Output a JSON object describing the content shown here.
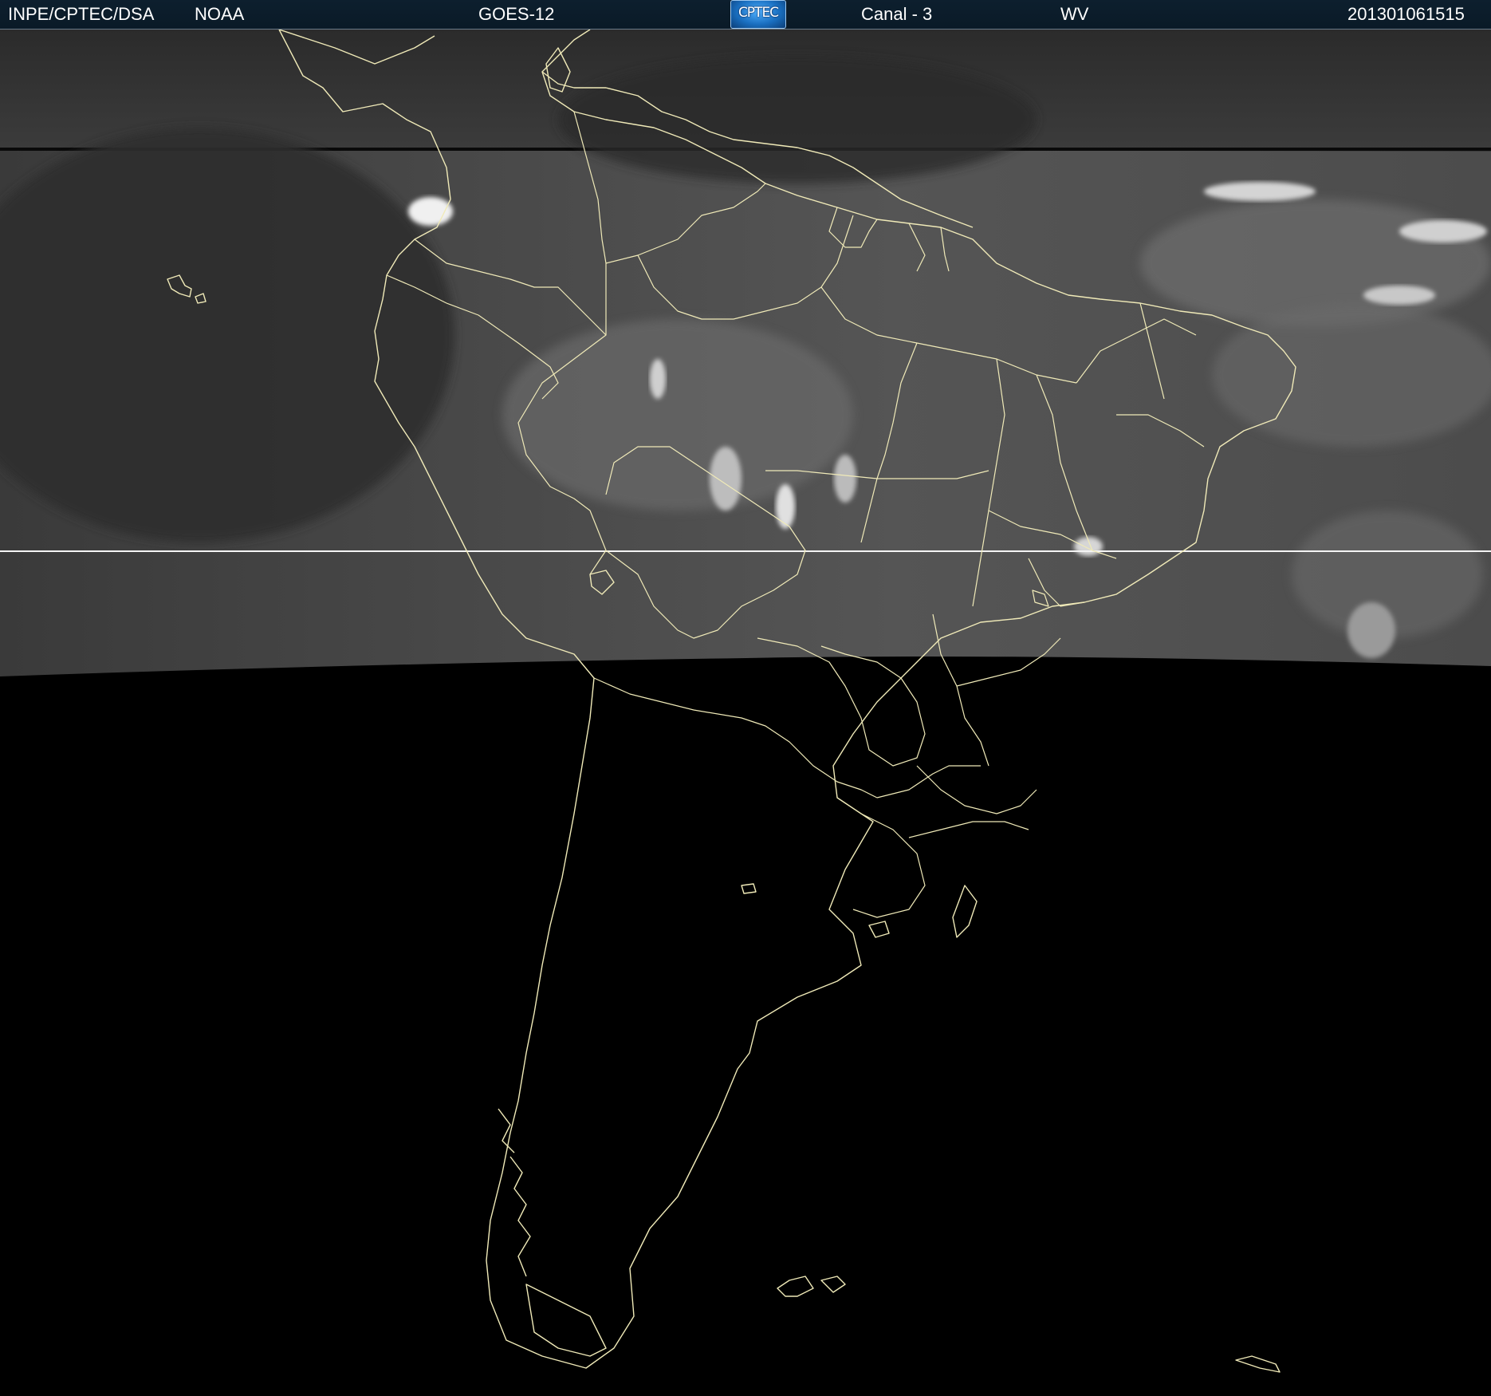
{
  "header": {
    "agency": "INPE/CPTEC/DSA",
    "source": "NOAA",
    "satellite": "GOES-12",
    "logo_text": "CPTEC",
    "channel": "Canal - 3",
    "band": "WV",
    "timestamp": "201301061515"
  },
  "map": {
    "image_type": "satellite water vapor imagery",
    "region": "South America",
    "coastline_color": "#f0eab8",
    "no_data_color": "#000000"
  }
}
